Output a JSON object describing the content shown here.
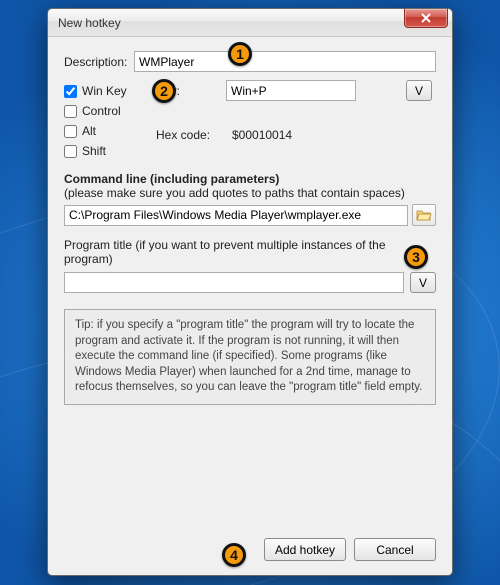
{
  "window": {
    "title": "New hotkey"
  },
  "description": {
    "label": "Description:",
    "value": "WMPlayer"
  },
  "modifiers": {
    "winkey": {
      "label": "Win Key",
      "checked": true
    },
    "control": {
      "label": "Control",
      "checked": false
    },
    "alt": {
      "label": "Alt",
      "checked": false
    },
    "shift": {
      "label": "Shift",
      "checked": false
    }
  },
  "key": {
    "label": "Key:",
    "value": "Win+P",
    "button": "V"
  },
  "hex": {
    "label": "Hex code:",
    "value": "$00010014"
  },
  "cmd": {
    "title": "Command line (including parameters)",
    "sub": "(please make sure you add quotes to paths that contain spaces)",
    "value": "C:\\Program Files\\Windows Media Player\\wmplayer.exe"
  },
  "progtitle": {
    "label": "Program title (if you want to prevent multiple instances of the program)",
    "value": "",
    "button": "V"
  },
  "tip": "Tip: if you specify a \"program title\" the program will try to locate the program and activate it. If the program is not running, it will then execute the command line (if specified). Some programs (like Windows Media Player) when launched for a 2nd time, manage to refocus themselves, so you can leave the \"program title\" field empty.",
  "buttons": {
    "add": "Add hotkey",
    "cancel": "Cancel"
  },
  "annotations": [
    "1",
    "2",
    "3",
    "4"
  ]
}
